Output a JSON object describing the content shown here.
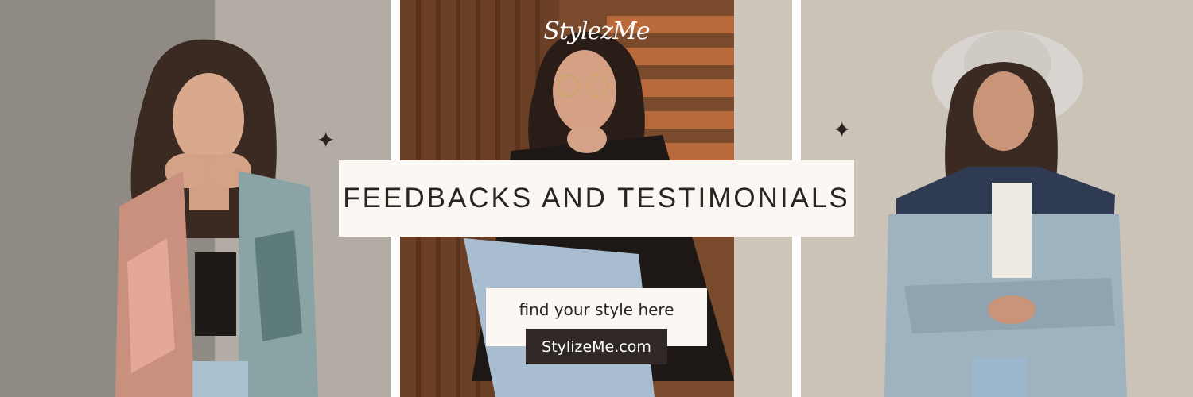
{
  "brand": {
    "logo_text": "StylezMe"
  },
  "banner": {
    "title": "FEEDBACKS AND TESTIMONIALS",
    "cta": "find your style here",
    "url": "StylizeMe.com"
  },
  "decor": {
    "sparkle_glyph": "✦"
  },
  "colors": {
    "title_box_bg": "#fbf8f4",
    "url_button_bg": "#2f2826",
    "text_dark": "#2b2520",
    "wall_left": "#a8a29a",
    "wall_right": "#c9c1b6",
    "wood": "#8a5230"
  }
}
